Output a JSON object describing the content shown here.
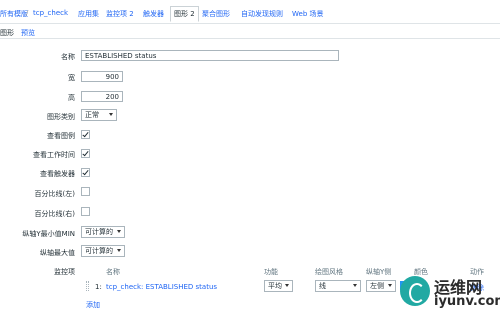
{
  "nav": {
    "all_graphs": "所有模版",
    "separator": "/",
    "template": "tcp_check",
    "applications": "应用集",
    "items": "监控项 2",
    "triggers": "触发器",
    "graphs": "图形 2",
    "aggregate": "聚合图形",
    "discovery": "自动发现规则",
    "web": "Web 场景"
  },
  "subtabs": {
    "graph": "图形",
    "preview": "预览"
  },
  "form": {
    "name_label": "名称",
    "name_value": "ESTABLISHED status",
    "width_label": "宽",
    "width_value": "900",
    "height_label": "高",
    "height_value": "200",
    "graph_type_label": "图形类别",
    "graph_type_value": "正常",
    "show_legend_label": "查看图例",
    "show_legend_checked": true,
    "show_working_time_label": "查看工作时间",
    "show_working_time_checked": true,
    "show_triggers_label": "查看触发器",
    "show_triggers_checked": true,
    "percentile_left_label": "百分比线(左)",
    "percentile_left_checked": false,
    "percentile_right_label": "百分比线(右)",
    "percentile_right_checked": false,
    "ymin_label": "纵轴Y最小值MIN",
    "ymin_value": "可计算的",
    "ymax_label": "纵轴最大值",
    "ymax_value": "可计算的"
  },
  "items": {
    "section_label": "监控项",
    "headers": {
      "name": "名称",
      "function": "功能",
      "drawstyle": "绘图风格",
      "yaxis": "纵轴Y侧",
      "color": "颜色",
      "action": "动作"
    },
    "rows": [
      {
        "index": "1:",
        "name": "tcp_check: ESTABLISHED status",
        "function": "平均",
        "drawstyle": "线",
        "yaxis": "左侧",
        "color_hex": "#2196F3",
        "action": "移除"
      }
    ],
    "add_label": "添加"
  },
  "watermark": {
    "title": "运维网",
    "subtitle": "iyunv.com",
    "color": "#21A9A3"
  }
}
